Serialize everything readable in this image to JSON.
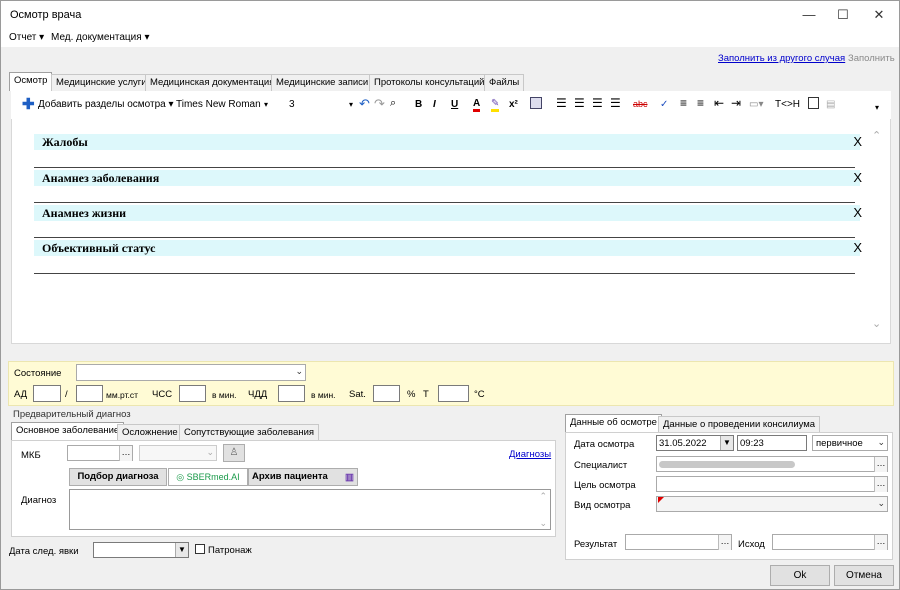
{
  "window": {
    "title": "Осмотр врача",
    "minimize": "—",
    "maximize": "☐",
    "close": "✕"
  },
  "menu": {
    "items": [
      {
        "label": "Отчет ▾"
      },
      {
        "label": "Мед. документация ▾"
      }
    ]
  },
  "links": {
    "fill_from_other": "Заполнить из другого случая",
    "fill": "Заполнить"
  },
  "tabs": [
    "Осмотр",
    "Медицинские услуги",
    "Медицинская документация",
    "Медицинские записи",
    "Протоколы консультаций",
    "Файлы"
  ],
  "toolbar": {
    "add_sections": "Добавить разделы осмотра ▾",
    "font": "Times New Roman",
    "size": "3",
    "bold": "B",
    "italic": "I",
    "underline": "U",
    "superscript": "x²",
    "html": "T<>H"
  },
  "sections": [
    {
      "title": "Жалобы",
      "remove": "X"
    },
    {
      "title": "Анамнез заболевания",
      "remove": "X"
    },
    {
      "title": "Анамнез жизни",
      "remove": "X"
    },
    {
      "title": "Объективный статус",
      "remove": "X"
    }
  ],
  "vitals": {
    "state_label": "Состояние",
    "ad": "АД",
    "slash": "/",
    "mmhg": "мм.рт.ст",
    "chss": "ЧСС",
    "per_min1": "в мин.",
    "chdd": "ЧДД",
    "per_min2": "в мин.",
    "sat": "Sat.",
    "percent": "%",
    "t": "Т",
    "celsius": "°С"
  },
  "diagnosis": {
    "group_title": "Предварительный диагноз",
    "tabs": [
      "Основное заболевание",
      "Осложнение",
      "Сопутствующие заболевания"
    ],
    "mkb_label": "МКБ",
    "diagnoses_link": "Диагнозы",
    "pick_button": "Подбор диагноза",
    "sber_logo": "SBERmed.AI",
    "archive_button": "Архив пациента",
    "diagnosis_label": "Диагноз"
  },
  "next_visit": {
    "label": "Дата след. явки",
    "patronage": "Патронаж"
  },
  "exam": {
    "tabs": [
      "Данные об осмотре",
      "Данные о проведении консилиума"
    ],
    "date_label": "Дата осмотра",
    "date": "31.05.2022",
    "time": "09:23",
    "type": "первичное",
    "specialist_label": "Специалист",
    "purpose_label": "Цель осмотра",
    "kind_label": "Вид осмотра",
    "result_label": "Результат",
    "outcome_label": "Исход"
  },
  "buttons": {
    "ok": "Ok",
    "cancel": "Отмена"
  },
  "colors": {
    "section_bg": "#ddf8fb",
    "vitals_bg": "#fffbd5",
    "link": "#0000cc"
  }
}
